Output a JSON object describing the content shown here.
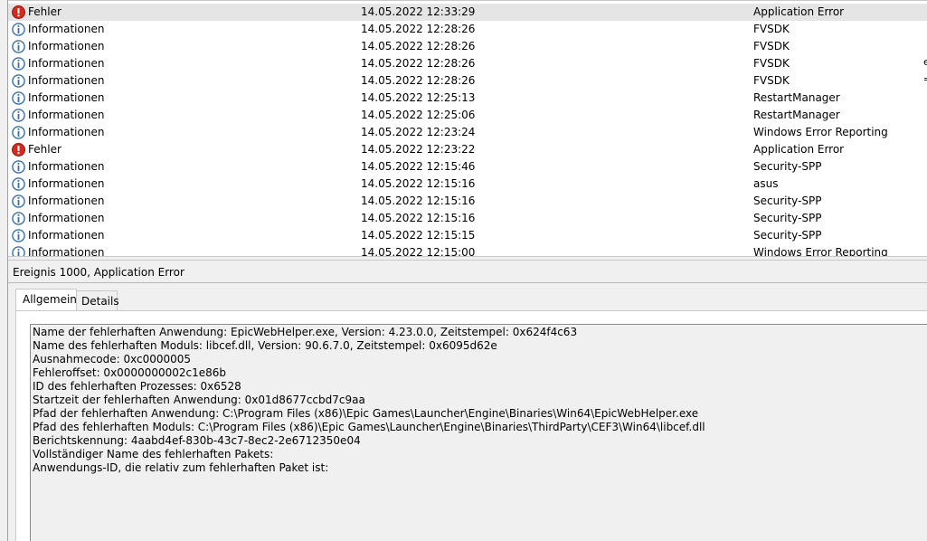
{
  "event_list": {
    "rows": [
      {
        "level": "Fehler",
        "icon": "error-icon",
        "date": "14.05.2022 12:33:29",
        "source": "Application Error",
        "selected": true
      },
      {
        "level": "Informationen",
        "icon": "info-icon",
        "date": "14.05.2022 12:28:26",
        "source": "FVSDK"
      },
      {
        "level": "Informationen",
        "icon": "info-icon",
        "date": "14.05.2022 12:28:26",
        "source": "FVSDK"
      },
      {
        "level": "Informationen",
        "icon": "info-icon",
        "date": "14.05.2022 12:28:26",
        "source": "FVSDK"
      },
      {
        "level": "Informationen",
        "icon": "info-icon",
        "date": "14.05.2022 12:28:26",
        "source": "FVSDK"
      },
      {
        "level": "Informationen",
        "icon": "info-icon",
        "date": "14.05.2022 12:25:13",
        "source": "RestartManager"
      },
      {
        "level": "Informationen",
        "icon": "info-icon",
        "date": "14.05.2022 12:25:06",
        "source": "RestartManager"
      },
      {
        "level": "Informationen",
        "icon": "info-icon",
        "date": "14.05.2022 12:23:24",
        "source": "Windows Error Reporting"
      },
      {
        "level": "Fehler",
        "icon": "error-icon",
        "date": "14.05.2022 12:23:22",
        "source": "Application Error"
      },
      {
        "level": "Informationen",
        "icon": "info-icon",
        "date": "14.05.2022 12:15:46",
        "source": "Security-SPP"
      },
      {
        "level": "Informationen",
        "icon": "info-icon",
        "date": "14.05.2022 12:15:16",
        "source": "asus"
      },
      {
        "level": "Informationen",
        "icon": "info-icon",
        "date": "14.05.2022 12:15:16",
        "source": "Security-SPP"
      },
      {
        "level": "Informationen",
        "icon": "info-icon",
        "date": "14.05.2022 12:15:16",
        "source": "Security-SPP"
      },
      {
        "level": "Informationen",
        "icon": "info-icon",
        "date": "14.05.2022 12:15:15",
        "source": "Security-SPP"
      },
      {
        "level": "Informationen",
        "icon": "info-icon",
        "date": "14.05.2022 12:15:00",
        "source": "Windows Error Reporting"
      }
    ],
    "edge_fragments": [
      "e",
      "="
    ]
  },
  "detail": {
    "title": "Ereignis 1000, Application Error",
    "tabs": [
      {
        "label": "Allgemein",
        "active": true
      },
      {
        "label": "Details",
        "active": false
      }
    ],
    "description_lines": [
      "Name der fehlerhaften Anwendung: EpicWebHelper.exe, Version: 4.23.0.0, Zeitstempel: 0x624f4c63",
      "Name des fehlerhaften Moduls: libcef.dll, Version: 90.6.7.0, Zeitstempel: 0x6095d62e",
      "Ausnahmecode: 0xc0000005",
      "Fehleroffset: 0x0000000002c1e86b",
      "ID des fehlerhaften Prozesses: 0x6528",
      "Startzeit der fehlerhaften Anwendung: 0x01d8677ccbd7c9aa",
      "Pfad der fehlerhaften Anwendung: C:\\Program Files (x86)\\Epic Games\\Launcher\\Engine\\Binaries\\Win64\\EpicWebHelper.exe",
      "Pfad des fehlerhaften Moduls: C:\\Program Files (x86)\\Epic Games\\Launcher\\Engine\\Binaries\\ThirdParty\\CEF3\\Win64\\libcef.dll",
      "Berichtskennung: 4aabd4ef-830b-43c7-8ec2-2e6712350e04",
      "Vollständiger Name des fehlerhaften Pakets:",
      "Anwendungs-ID, die relativ zum fehlerhaften Paket ist:"
    ]
  },
  "colors": {
    "error_red": "#d62a1f",
    "info_blue": "#3a6ea5",
    "selected_row": "#e5e5e5",
    "pane_background": "#f0f0f0"
  }
}
